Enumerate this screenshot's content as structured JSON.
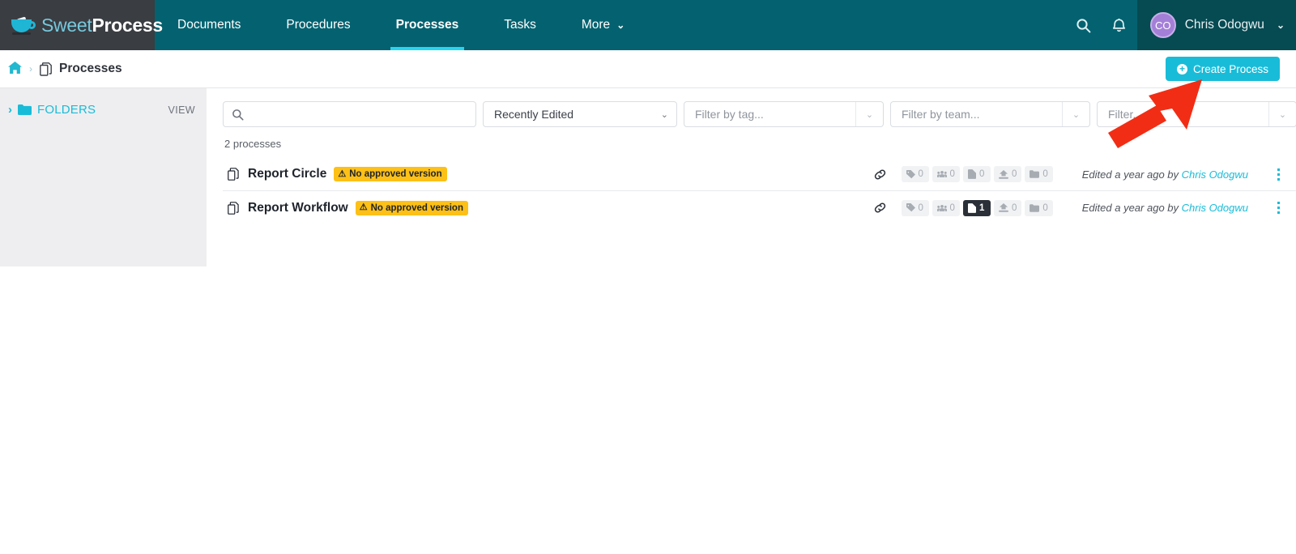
{
  "app": {
    "logo_sweet": "Sweet",
    "logo_process": "Process",
    "logo_icon": "coffee-cup-icon"
  },
  "topnav": {
    "links": [
      {
        "label": "Documents",
        "active": false
      },
      {
        "label": "Procedures",
        "active": false
      },
      {
        "label": "Processes",
        "active": true
      },
      {
        "label": "Tasks",
        "active": false
      },
      {
        "label": "More",
        "active": false,
        "caret": "⌄"
      }
    ],
    "search_icon": "search-icon",
    "notifications_icon": "bell-icon",
    "user": {
      "initials": "CO",
      "name": "Chris Odogwu",
      "caret": "⌄"
    }
  },
  "breadcrumb": {
    "home_icon": "home-icon",
    "separator": "›",
    "page_icon": "processes-icon",
    "label": "Processes"
  },
  "actions": {
    "create_label": "Create Process",
    "create_plus": "+",
    "create_color": "#19bcd8"
  },
  "sidebar": {
    "chevron": "›",
    "folder_icon": "folder-icon",
    "folders_label": "FOLDERS",
    "view_label": "VIEW"
  },
  "filters": {
    "search": {
      "value": "",
      "placeholder": "",
      "icon": "search-icon"
    },
    "sort": {
      "value": "Recently Edited",
      "chevron": "⌄"
    },
    "tag": {
      "placeholder": "Filter by tag...",
      "chevron": "⌄"
    },
    "team": {
      "placeholder": "Filter by team...",
      "chevron": "⌄"
    },
    "other": {
      "placeholder": "Filter...",
      "chevron": "⌄"
    }
  },
  "list": {
    "count_label": "2 processes",
    "rows": [
      {
        "doc_icon": "copy-document-icon",
        "title": "Report Circle",
        "badge": "No approved version",
        "badge_icon": "⚠",
        "link_icon": "link-icon",
        "chips": [
          {
            "icon": "tag-icon",
            "value": "0",
            "highlight": false
          },
          {
            "icon": "team-icon",
            "value": "0",
            "highlight": false
          },
          {
            "icon": "file-icon",
            "value": "0",
            "highlight": false
          },
          {
            "icon": "upload-icon",
            "value": "0",
            "highlight": false
          },
          {
            "icon": "folder-icon",
            "value": "0",
            "highlight": false
          }
        ],
        "edited_prefix": "Edited a year ago by ",
        "edited_author": "Chris Odogwu",
        "menu_icon": "kebab-menu-icon"
      },
      {
        "doc_icon": "copy-document-icon",
        "title": "Report Workflow",
        "badge": "No approved version",
        "badge_icon": "⚠",
        "link_icon": "link-icon",
        "chips": [
          {
            "icon": "tag-icon",
            "value": "0",
            "highlight": false
          },
          {
            "icon": "team-icon",
            "value": "0",
            "highlight": false
          },
          {
            "icon": "file-icon",
            "value": "1",
            "highlight": true
          },
          {
            "icon": "upload-icon",
            "value": "0",
            "highlight": false
          },
          {
            "icon": "folder-icon",
            "value": "0",
            "highlight": false
          }
        ],
        "edited_prefix": "Edited a year ago by ",
        "edited_author": "Chris Odogwu",
        "menu_icon": "kebab-menu-icon"
      }
    ]
  },
  "annotation": {
    "arrow_color": "#f22d15",
    "arrow_target": "create-process-button"
  },
  "colors": {
    "nav_bg": "#046270",
    "logo_bg": "#3a3d42",
    "user_bg": "#064a52",
    "accent": "#19bcd8",
    "active_underline": "#25d5f2",
    "badge_yellow": "#fcc017",
    "sidebar_bg": "#eeeef0"
  }
}
